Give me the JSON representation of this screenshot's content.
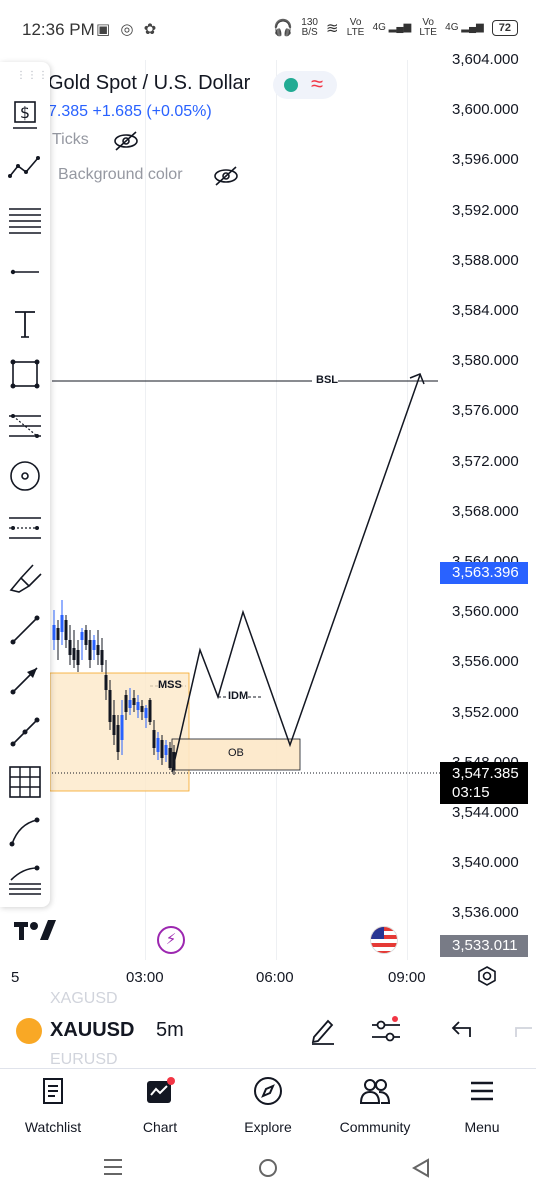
{
  "status_bar": {
    "time": "12:36 PM",
    "notif_icons": [
      "image-icon",
      "whatsapp-icon",
      "android-icon"
    ],
    "net_speed_value": "130",
    "net_speed_unit": "B/S",
    "net1": "Vo LTE",
    "net1_gen": "4G",
    "net2": "Vo LTE",
    "net2_gen": "4G",
    "battery": "72"
  },
  "legend": {
    "title": "Gold Spot / U.S. Dollar",
    "price_change": "7.385  +1.685 (+0.05%)",
    "ticks_label": "Ticks",
    "background_label": "Background color"
  },
  "price_axis": [
    "3,604.000",
    "3,600.000",
    "3,596.000",
    "3,592.000",
    "3,588.000",
    "3,584.000",
    "3,580.000",
    "3,576.000",
    "3,572.000",
    "3,568.000",
    "3,564.000",
    "3,560.000",
    "3,556.000",
    "3,552.000",
    "3,548.000",
    "3,544.000",
    "3,540.000",
    "3,536.000"
  ],
  "badges": {
    "current_blue": "3,563.396",
    "last_price": "3,547.385",
    "countdown": "03:15",
    "low_gray": "3,533.011"
  },
  "annotations": {
    "bsl": "BSL",
    "mss": "MSS",
    "idm": "IDM",
    "ob": "OB"
  },
  "time_axis": {
    "left_partial": "5",
    "t1": "03:00",
    "t2": "06:00",
    "t3": "09:00"
  },
  "symbol_bar": {
    "prev_symbol": "XAGUSD",
    "symbol": "XAUUSD",
    "next_symbol": "EURUSD",
    "interval": "5m"
  },
  "nav": {
    "watchlist": "Watchlist",
    "chart": "Chart",
    "explore": "Explore",
    "community": "Community",
    "menu": "Menu"
  },
  "colors": {
    "accent_blue": "#2962ff",
    "bull": "#2962ff",
    "bear": "#131722",
    "zone_fill": "#fde8c8",
    "zone_stroke": "#f5a623",
    "badge_black": "#000000",
    "badge_gray": "#787b86"
  }
}
